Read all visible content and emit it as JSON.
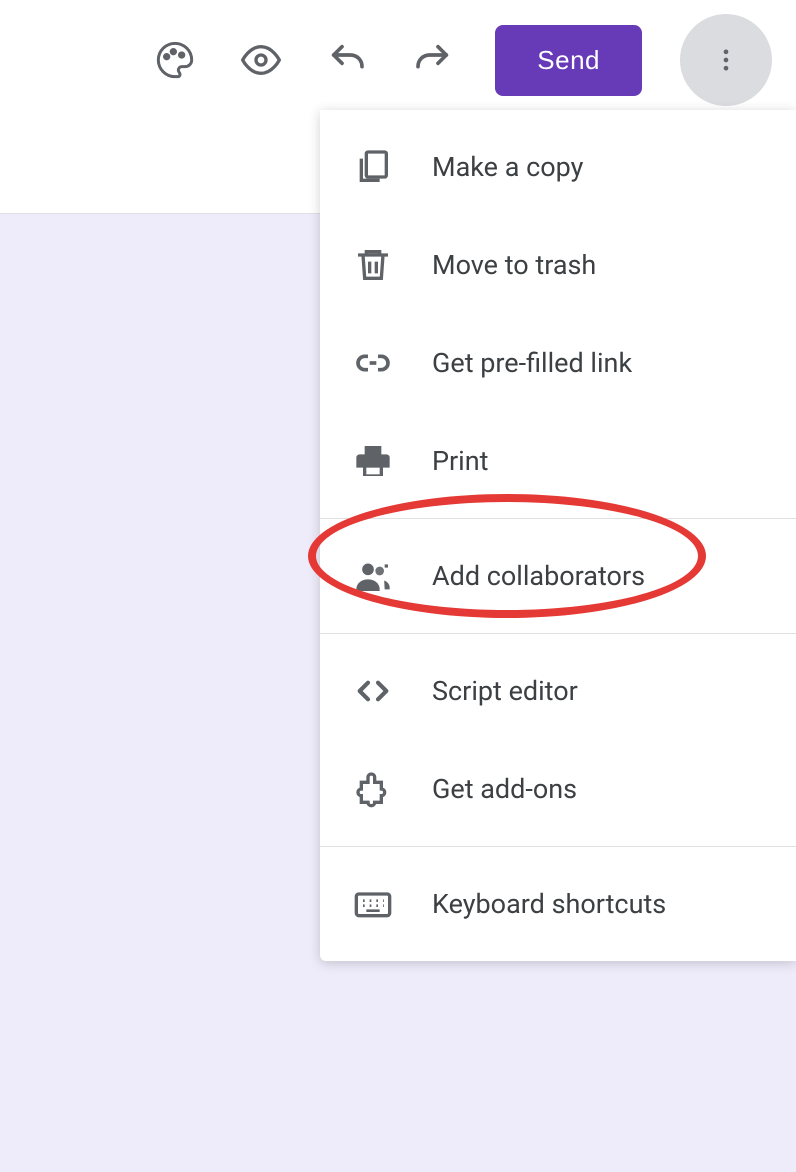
{
  "toolbar": {
    "send_label": "Send"
  },
  "menu": {
    "section1": [
      {
        "label": "Make a copy"
      },
      {
        "label": "Move to trash"
      },
      {
        "label": "Get pre-filled link"
      },
      {
        "label": "Print"
      }
    ],
    "section2": [
      {
        "label": "Add collaborators"
      }
    ],
    "section3": [
      {
        "label": "Script editor"
      },
      {
        "label": "Get add-ons"
      }
    ],
    "section4": [
      {
        "label": "Keyboard shortcuts"
      }
    ]
  },
  "highlight": {
    "target": "add-collaborators"
  }
}
